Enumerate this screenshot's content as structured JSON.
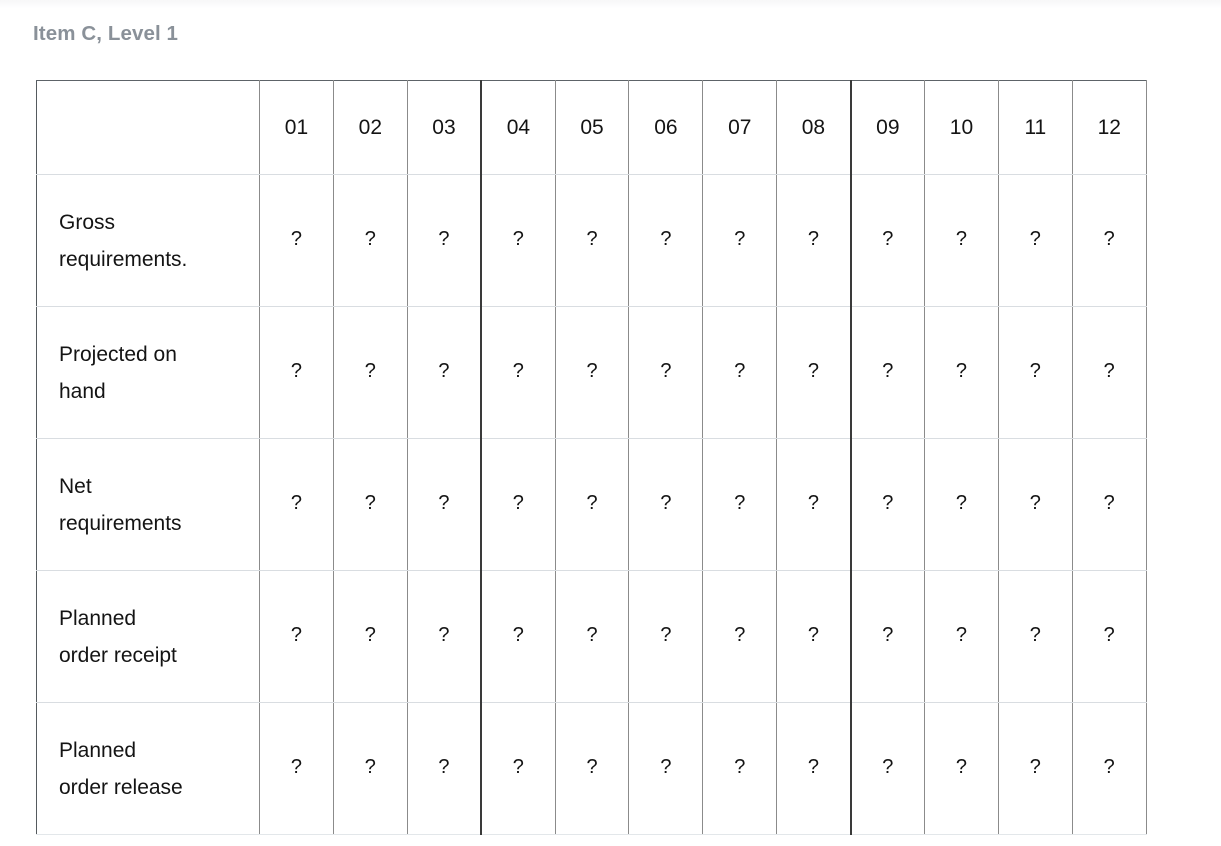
{
  "page": {
    "title": "Item C, Level 1",
    "title_color": "#8a9199",
    "background": "#ffffff"
  },
  "table": {
    "corner_header": "",
    "period_headers": [
      "01",
      "02",
      "03",
      "04",
      "05",
      "06",
      "07",
      "08",
      "09",
      "10",
      "11",
      "12"
    ],
    "emphasized_separators_after": [
      "03",
      "08"
    ],
    "border_colors": {
      "outer": "#555a5e",
      "vertical_light": "#8b8b8b",
      "horizontal_light": "#d9dde1",
      "emphasized": "#3a3a3a"
    },
    "rows": [
      {
        "label": "Gross requirements.",
        "label_lines": [
          "Gross",
          "requirements."
        ],
        "values": [
          "?",
          "?",
          "?",
          "?",
          "?",
          "?",
          "?",
          "?",
          "?",
          "?",
          "?",
          "?"
        ]
      },
      {
        "label": "Projected on hand",
        "label_lines": [
          "Projected on",
          "hand"
        ],
        "values": [
          "?",
          "?",
          "?",
          "?",
          "?",
          "?",
          "?",
          "?",
          "?",
          "?",
          "?",
          "?"
        ]
      },
      {
        "label": "Net requirements",
        "label_lines": [
          "Net",
          "requirements"
        ],
        "values": [
          "?",
          "?",
          "?",
          "?",
          "?",
          "?",
          "?",
          "?",
          "?",
          "?",
          "?",
          "?"
        ]
      },
      {
        "label": "Planned order receipt",
        "label_lines": [
          "Planned",
          "order receipt"
        ],
        "values": [
          "?",
          "?",
          "?",
          "?",
          "?",
          "?",
          "?",
          "?",
          "?",
          "?",
          "?",
          "?"
        ]
      },
      {
        "label": "Planned order release",
        "label_lines": [
          "Planned",
          "order release"
        ],
        "values": [
          "?",
          "?",
          "?",
          "?",
          "?",
          "?",
          "?",
          "?",
          "?",
          "?",
          "?",
          "?"
        ]
      }
    ]
  }
}
